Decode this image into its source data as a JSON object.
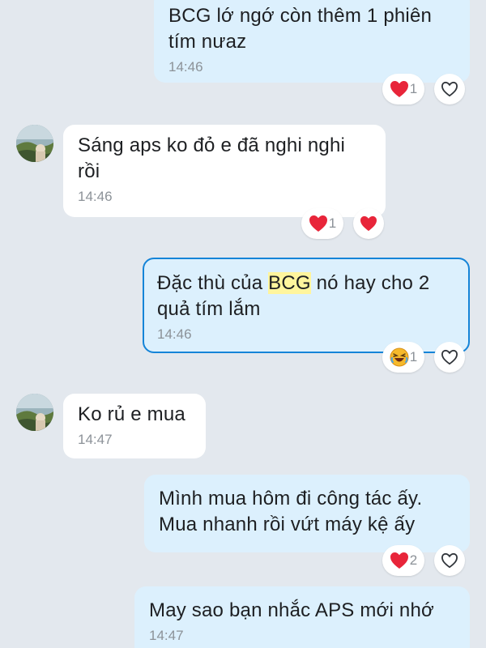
{
  "messages": [
    {
      "id": "m1",
      "direction": "sent",
      "text": "BCG lớ ngớ còn thêm 1 phiên\ntím nưaz",
      "time": "14:46",
      "reaction": {
        "icon": "heart-icon",
        "count": "1"
      },
      "reaction_button": "heart-outline-icon"
    },
    {
      "id": "m2",
      "direction": "received",
      "text": "Sáng aps ko đỏ e đã nghi nghi\nrồi",
      "time": "14:46",
      "reaction": {
        "icon": "heart-icon",
        "count": "1"
      },
      "reaction_button": "heart-filled-icon"
    },
    {
      "id": "m3",
      "direction": "sent",
      "text_before": "Đặc thù của ",
      "text_highlight": "BCG",
      "text_after": " nó hay cho 2\nquả tím lắm",
      "time": "14:46",
      "reaction": {
        "icon": "laughing-emoji-icon",
        "count": "1"
      },
      "reaction_button": "heart-outline-icon"
    },
    {
      "id": "m4",
      "direction": "received",
      "text": "Ko rủ e mua",
      "time": "14:47"
    },
    {
      "id": "m5",
      "direction": "sent",
      "text": "Mình mua hôm đi công tác ấy.\nMua nhanh rồi vứt máy kệ ấy",
      "reaction": {
        "icon": "heart-icon",
        "count": "2"
      },
      "reaction_button": "heart-outline-icon"
    },
    {
      "id": "m6",
      "direction": "sent",
      "text": "May sao bạn nhắc APS mới nhớ",
      "time": "14:47"
    }
  ],
  "colors": {
    "background": "#e3e8ee",
    "sent_bubble": "#dcf0fd",
    "received_bubble": "#ffffff",
    "focus_border": "#1584d8",
    "highlight": "#fff59d",
    "heart": "#e8253a",
    "time_text": "#8c9298"
  }
}
